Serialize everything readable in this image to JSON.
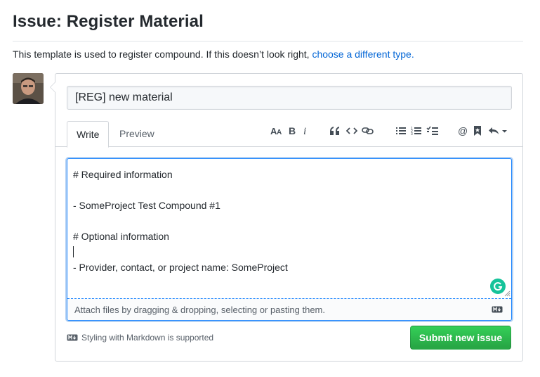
{
  "page": {
    "title": "Issue: Register Material",
    "template_note": "This template is used to register compound. If this doesn’t look right,",
    "template_link": "choose a different type."
  },
  "issue": {
    "title_value": "[REG] new material"
  },
  "tabs": [
    {
      "label": "Write",
      "active": true
    },
    {
      "label": "Preview",
      "active": false
    }
  ],
  "toolbar": {
    "icons": [
      "text-size-icon",
      "bold-icon",
      "italic-icon",
      "quote-icon",
      "code-icon",
      "link-icon",
      "unordered-list-icon",
      "ordered-list-icon",
      "task-list-icon",
      "mention-icon",
      "saved-reply-icon",
      "reply-icon"
    ]
  },
  "editor": {
    "lines": [
      "# Required information",
      "",
      "- SomeProject Test Compound #1",
      "",
      "# Optional information",
      "",
      "- Provider, contact, or project name: SomeProject"
    ],
    "attach_hint": "Attach files by dragging & dropping, selecting or pasting them."
  },
  "footer": {
    "markdown_note": "Styling with Markdown is supported",
    "submit_label": "Submit new issue"
  },
  "colors": {
    "link": "#0366d6",
    "submit_green": "#2ea44f",
    "focus_blue": "#2188ff",
    "grammarly": "#15c39a"
  }
}
